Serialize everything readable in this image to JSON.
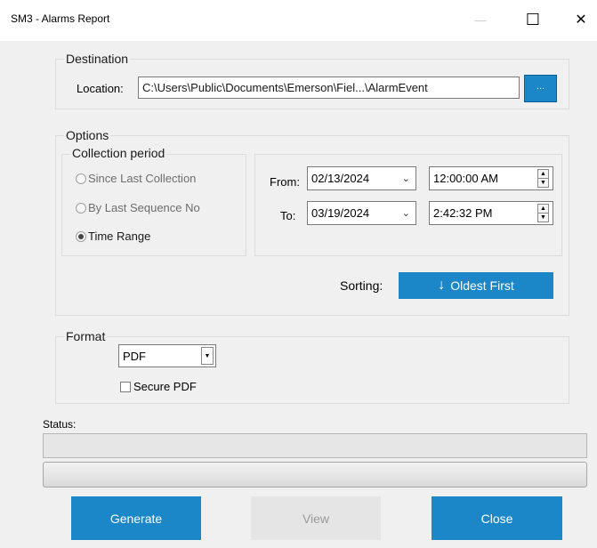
{
  "window": {
    "title": "SM3 - Alarms Report",
    "minimize_glyph": "—",
    "maximize_glyph": "☐",
    "close_glyph": "✕"
  },
  "destination": {
    "legend": "Destination",
    "location_label": "Location:",
    "location_value": "C:\\Users\\Public\\Documents\\Emerson\\Fiel...\\AlarmEvent",
    "browse_label": "..."
  },
  "options": {
    "legend": "Options",
    "collection_period": {
      "legend": "Collection period",
      "items": [
        {
          "label": "Since Last Collection",
          "checked": false
        },
        {
          "label": "By Last Sequence No",
          "checked": false
        },
        {
          "label": "Time Range",
          "checked": true
        }
      ]
    },
    "from_label": "From:",
    "from_date": "02/13/2024",
    "from_time": "12:00:00 AM",
    "to_label": "To:",
    "to_date": "03/19/2024",
    "to_time": "2:42:32 PM",
    "sorting_label": "Sorting:",
    "sorting_button": "Oldest First"
  },
  "format": {
    "legend": "Format",
    "selected": "PDF",
    "secure_pdf_label": "Secure PDF",
    "secure_pdf_checked": false
  },
  "status": {
    "label": "Status:"
  },
  "buttons": {
    "generate": "Generate",
    "view": "View",
    "close": "Close"
  },
  "colors": {
    "accent": "#1b87c9",
    "disabled": "#e5e5e5"
  }
}
